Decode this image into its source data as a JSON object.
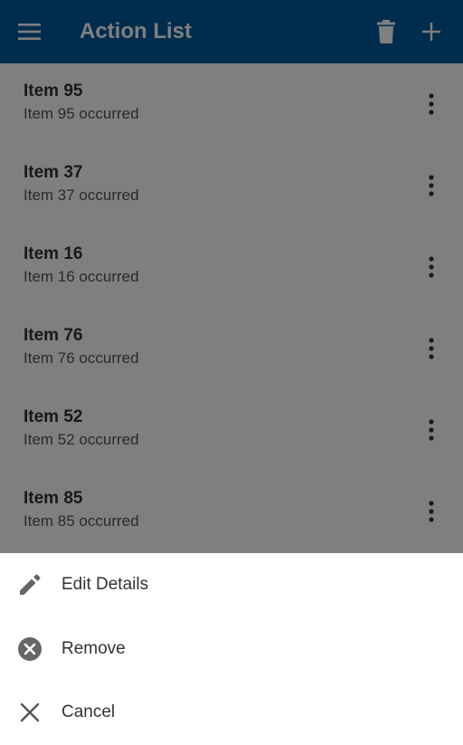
{
  "app_bar": {
    "title": "Action List",
    "menu_icon": "menu-icon",
    "delete_icon": "delete-icon",
    "add_icon": "add-icon",
    "color": "#005a9c"
  },
  "list": {
    "items": [
      {
        "title": "Item 95",
        "subtitle": "Item 95 occurred"
      },
      {
        "title": "Item 37",
        "subtitle": "Item 37 occurred"
      },
      {
        "title": "Item 16",
        "subtitle": "Item 16 occurred"
      },
      {
        "title": "Item 76",
        "subtitle": "Item 76 occurred"
      },
      {
        "title": "Item 52",
        "subtitle": "Item 52 occurred"
      },
      {
        "title": "Item 85",
        "subtitle": "Item 85 occurred"
      }
    ]
  },
  "bottom_sheet": {
    "actions": [
      {
        "label": "Edit Details",
        "icon": "pencil-icon"
      },
      {
        "label": "Remove",
        "icon": "remove-circle-icon"
      },
      {
        "label": "Cancel",
        "icon": "close-icon"
      }
    ]
  }
}
